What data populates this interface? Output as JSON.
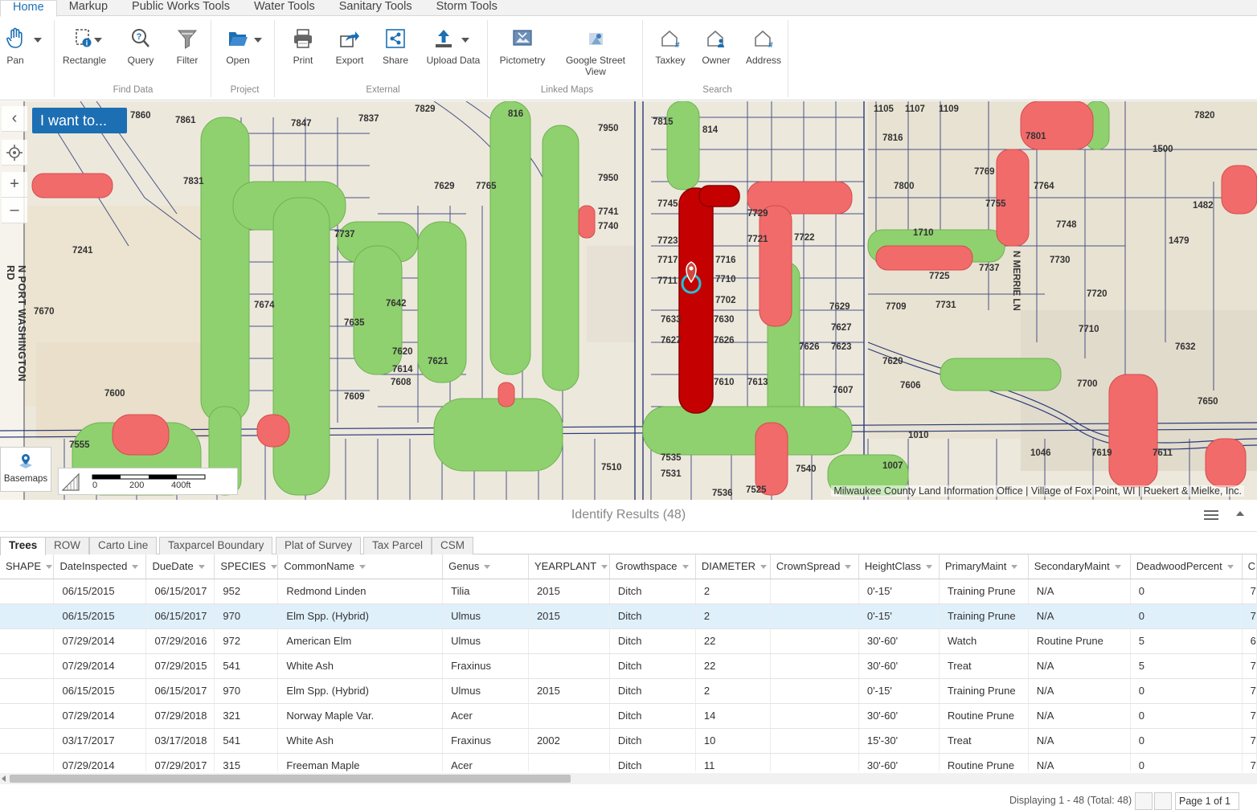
{
  "tabs": [
    "Home",
    "Markup",
    "Public Works Tools",
    "Water Tools",
    "Sanitary Tools",
    "Storm Tools"
  ],
  "ribbon": {
    "pan": "Pan",
    "find_data": {
      "label": "Find Data",
      "rectangle": "Rectangle",
      "query": "Query",
      "filter": "Filter"
    },
    "project": {
      "label": "Project",
      "open": "Open"
    },
    "external": {
      "label": "External",
      "print": "Print",
      "export": "Export",
      "share": "Share",
      "upload": "Upload Data"
    },
    "linked_maps": {
      "label": "Linked Maps",
      "pictometry": "Pictometry",
      "streetview": "Google Street View"
    },
    "search": {
      "label": "Search",
      "taxkey": "Taxkey",
      "owner": "Owner",
      "address": "Address"
    }
  },
  "map": {
    "i_want_to": "I want to...",
    "basemaps": "Basemaps",
    "scale_labels": [
      "0",
      "200",
      "400ft"
    ],
    "attribution": "Milwaukee County Land Information Office | Village of Fox Point, WI | Ruekert & Mielke, Inc.",
    "street_labels": [
      "N PORT WASHINGTON RD",
      "N MERRIE LN"
    ],
    "lot_numbers": [
      "7860",
      "7861",
      "7847",
      "7837",
      "7829",
      "816",
      "7950",
      "7815",
      "814",
      "1105",
      "1107",
      "1109",
      "7820",
      "7816",
      "7801",
      "1500",
      "7769",
      "7831",
      "7800",
      "7764",
      "7765",
      "7629",
      "7950",
      "1482",
      "7741",
      "7740",
      "7745",
      "7729",
      "7722",
      "7755",
      "7748",
      "1479",
      "7241",
      "7737",
      "7723",
      "7721",
      "1710",
      "7730",
      "7717",
      "7716",
      "7711",
      "7710",
      "7737",
      "7725",
      "7720",
      "7670",
      "7674",
      "7642",
      "7702",
      "7629",
      "7709",
      "7731",
      "7710",
      "7635",
      "7633",
      "7630",
      "7627",
      "7632",
      "7620",
      "7614",
      "7621",
      "7627",
      "7626",
      "7626",
      "7623",
      "7620",
      "7600",
      "7608",
      "7609",
      "7610",
      "7613",
      "7607",
      "7606",
      "7700",
      "7650",
      "7555",
      "7535",
      "7510",
      "7531",
      "7536",
      "7525",
      "7540",
      "1007",
      "1046",
      "7619",
      "7611",
      "1010"
    ]
  },
  "results": {
    "title": "Identify Results (48)",
    "tabs": [
      "Trees",
      "ROW",
      "Carto Line",
      "Taxparcel Boundary",
      "Plat of Survey",
      "Tax Parcel",
      "CSM"
    ],
    "columns": [
      "SHAPE",
      "DateInspected",
      "DueDate",
      "SPECIES",
      "CommonName",
      "Genus",
      "YEARPLANT",
      "Growthspace",
      "DIAMETER",
      "CrownSpread",
      "HeightClass",
      "PrimaryMaint",
      "SecondaryMaint",
      "DeadwoodPercent",
      "C"
    ],
    "rows": [
      [
        "",
        "06/15/2015",
        "06/15/2017",
        "952",
        "Redmond Linden",
        "Tilia",
        "2015",
        "Ditch",
        "2",
        "",
        "0'-15'",
        "Training Prune",
        "N/A",
        "0",
        "7"
      ],
      [
        "",
        "06/15/2015",
        "06/15/2017",
        "970",
        "Elm Spp. (Hybrid)",
        "Ulmus",
        "2015",
        "Ditch",
        "2",
        "",
        "0'-15'",
        "Training Prune",
        "N/A",
        "0",
        "7"
      ],
      [
        "",
        "07/29/2014",
        "07/29/2016",
        "972",
        "American Elm",
        "Ulmus",
        "",
        "Ditch",
        "22",
        "",
        "30'-60'",
        "Watch",
        "Routine Prune",
        "5",
        "6"
      ],
      [
        "",
        "07/29/2014",
        "07/29/2015",
        "541",
        "White Ash",
        "Fraxinus",
        "",
        "Ditch",
        "22",
        "",
        "30'-60'",
        "Treat",
        "N/A",
        "5",
        "7"
      ],
      [
        "",
        "06/15/2015",
        "06/15/2017",
        "970",
        "Elm Spp. (Hybrid)",
        "Ulmus",
        "2015",
        "Ditch",
        "2",
        "",
        "0'-15'",
        "Training Prune",
        "N/A",
        "0",
        "7"
      ],
      [
        "",
        "07/29/2014",
        "07/29/2018",
        "321",
        "Norway Maple Var.",
        "Acer",
        "",
        "Ditch",
        "14",
        "",
        "30'-60'",
        "Routine Prune",
        "N/A",
        "0",
        "7"
      ],
      [
        "",
        "03/17/2017",
        "03/17/2018",
        "541",
        "White Ash",
        "Fraxinus",
        "2002",
        "Ditch",
        "10",
        "",
        "15'-30'",
        "Treat",
        "N/A",
        "0",
        "7"
      ],
      [
        "",
        "07/29/2014",
        "07/29/2017",
        "315",
        "Freeman Maple",
        "Acer",
        "",
        "Ditch",
        "11",
        "",
        "30'-60'",
        "Routine Prune",
        "N/A",
        "0",
        "7"
      ]
    ],
    "selected_row": 1,
    "footer": "Displaying 1 - 48 (Total: 48)",
    "page": "Page 1 of 1"
  },
  "colors": {
    "accent": "#1c6fb3",
    "tree_green": "#8fd16f",
    "tree_red": "#f26b6b",
    "tree_selected": "#c40000",
    "parcel_line": "#2b3a7a",
    "map_base": "#ede8dc"
  }
}
